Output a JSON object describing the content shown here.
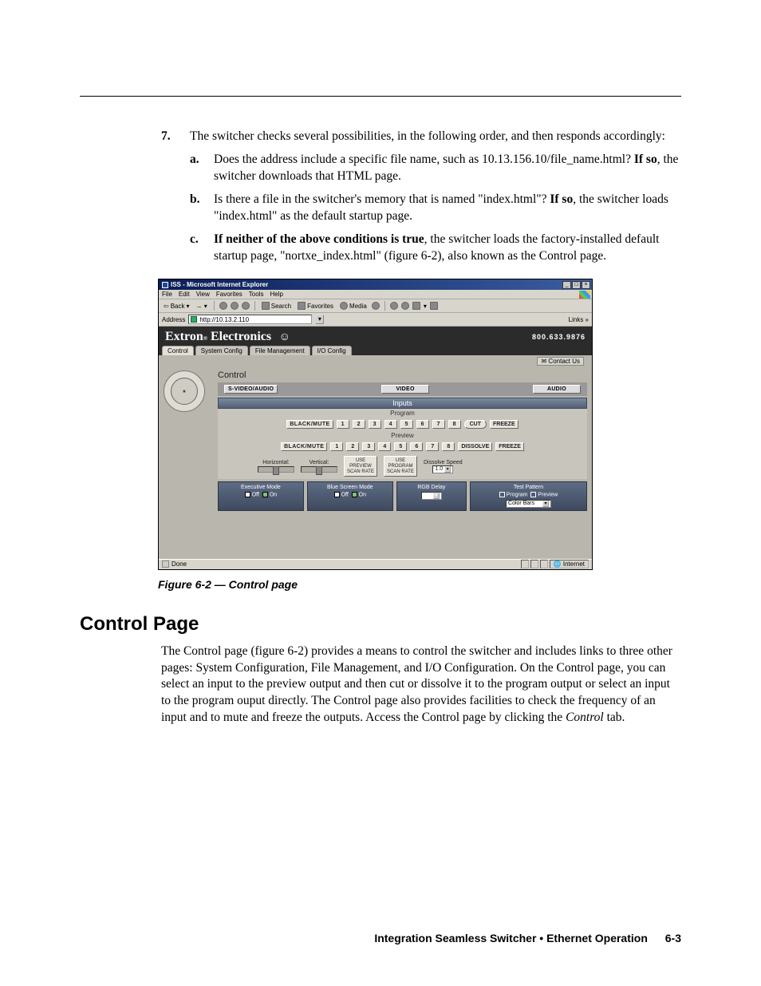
{
  "list7": {
    "num": "7.",
    "text": "The switcher checks several possibilities, in the following order, and then responds accordingly:",
    "a": {
      "letter": "a.",
      "t1": "Does the address include a specific file name, such as 10.13.156.10/file_name.html?  ",
      "bold": "If so",
      "t2": ", the switcher downloads that HTML page."
    },
    "b": {
      "letter": "b.",
      "t1": "Is there a file in the switcher's memory that is named \"index.html\"? ",
      "bold": "If so",
      "t2": ", the switcher loads \"index.html\" as the default startup page."
    },
    "c": {
      "letter": "c.",
      "bold": "If neither of the above conditions is true",
      "t2": ", the switcher loads the factory-installed default startup page, \"nortxe_index.html\" (figure 6-2), also known as the Control page."
    }
  },
  "ie": {
    "title": "ISS - Microsoft Internet Explorer",
    "menu": {
      "file": "File",
      "edit": "Edit",
      "view": "View",
      "favorites": "Favorites",
      "tools": "Tools",
      "help": "Help"
    },
    "toolbar": {
      "back": "Back",
      "search": "Search",
      "favorites": "Favorites",
      "media": "Media"
    },
    "address_label": "Address",
    "url": "http://10.13.2.110",
    "links": "Links »",
    "status_done": "Done",
    "status_zone": "Internet"
  },
  "ext": {
    "brand1": "Extron",
    "brand2": "Electronics",
    "phone": "800.633.9876",
    "tabs": {
      "control": "Control",
      "system": "System Config",
      "file": "File Management",
      "io": "I/O Config"
    },
    "contact": "Contact Us"
  },
  "ctrl": {
    "title": "Control",
    "sv": "S-VIDEO/AUDIO",
    "video": "VIDEO",
    "audio": "AUDIO",
    "inputs": "Inputs",
    "program": "Program",
    "preview": "Preview",
    "black_mute": "BLACK/MUTE",
    "n1": "1",
    "n2": "2",
    "n3": "3",
    "n4": "4",
    "n5": "5",
    "n6": "6",
    "n7": "7",
    "n8": "8",
    "cut": "CUT",
    "dissolve": "DISSOLVE",
    "freeze": "FREEZE",
    "horizontal": "Horizontal:",
    "vertical": "Vertical:",
    "use_preview": "USE PREVIEW SCAN RATE",
    "use_program": "USE PROGRAM SCAN RATE",
    "dissolve_speed": "Dissolve Speed",
    "speed_val": "1.0",
    "exec_mode": "Executive Mode",
    "bluescreen": "Blue Screen Mode",
    "off": "Off",
    "on": "On",
    "rgb_delay": "RGB Delay",
    "rgb_val": "0.0",
    "test_pattern": "Test Pattern",
    "tp_program": "Program",
    "tp_preview": "Preview",
    "color_bars": "Color Bars"
  },
  "caption": "Figure 6-2 — Control page",
  "section": {
    "heading": "Control Page",
    "p1a": "The Control page (figure 6-2) provides a means to control the switcher and includes links to three other pages: System Configuration, File Management, and I/O Configuration.  On the Control page, you can select an input to the preview output and then cut or dissolve it to the program output or select an input to the program ouput directly.  The Control page also provides facilities to check the frequency of an input and to mute and freeze the outputs.  Access the Control page by clicking the ",
    "p1_italic": "Control",
    "p1b": " tab."
  },
  "footer": {
    "title": "Integration Seamless Switcher • Ethernet Operation",
    "page": "6-3"
  }
}
